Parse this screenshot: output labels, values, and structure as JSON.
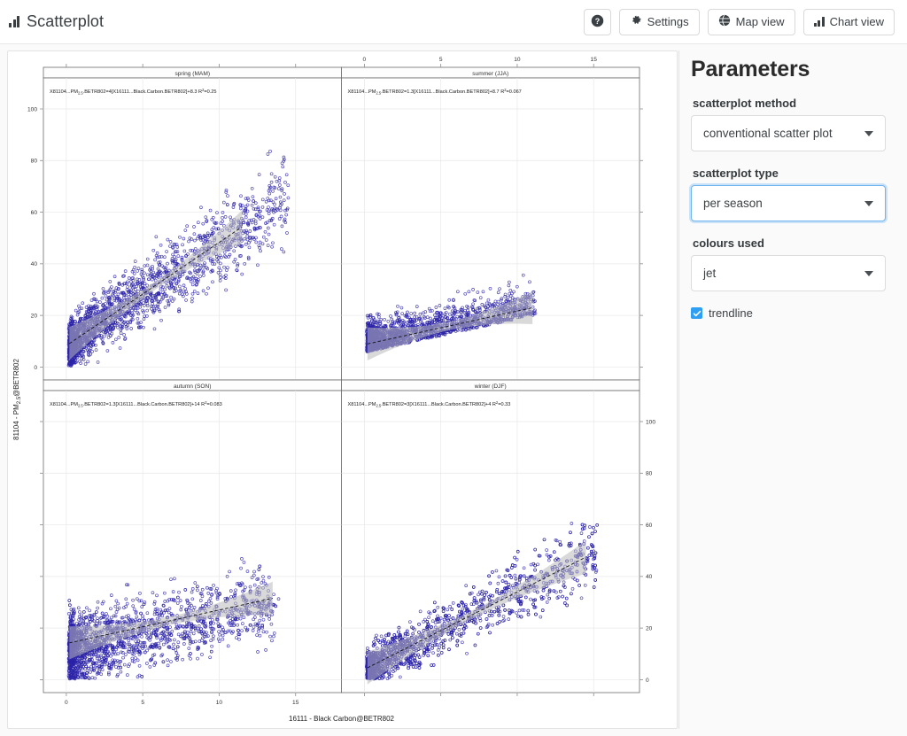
{
  "app": {
    "title": "Scatterplot",
    "logo_icon": "bar-chart-icon"
  },
  "toolbar": {
    "help_label": "?",
    "help_icon": "help-circle-icon",
    "settings_label": "Settings",
    "settings_icon": "gear-icon",
    "map_view_label": "Map view",
    "map_view_icon": "globe-icon",
    "chart_view_label": "Chart view",
    "chart_view_icon": "bar-chart-icon"
  },
  "sidebar": {
    "title": "Parameters",
    "fields": [
      {
        "label": "scatterplot method",
        "value": "conventional scatter plot",
        "focused": false
      },
      {
        "label": "scatterplot type",
        "value": "per season",
        "focused": true
      },
      {
        "label": "colours used",
        "value": "jet",
        "focused": false
      }
    ],
    "checkbox": {
      "label": "trendline",
      "checked": true,
      "accent": "#2e9ff2"
    }
  },
  "chart_data": {
    "type": "scatter",
    "title": "",
    "xlabel": "16111 - Black Carbon@BETR802",
    "ylabel": "81104 - PM2.5@BETR802",
    "layout": "2x2 facet (lattice/trellis)",
    "legend": "none",
    "grid": true,
    "point_color": "#2a22a8",
    "point_style": "open circle",
    "trendline": {
      "shown": true,
      "style": "dashed black line with grey confidence band"
    },
    "xlim": [
      -1.5,
      18
    ],
    "ylim": [
      -5,
      112
    ],
    "xticks": [
      0,
      5,
      10,
      15
    ],
    "yticks": [
      0,
      20,
      40,
      60,
      80,
      100
    ],
    "panels": [
      {
        "strip": "spring (MAM)",
        "position": "top-left",
        "equation": "X81104...PM2.5.BETR802=4[X16111...Black.Carbon.BETR802]+8.3 R²=0.25",
        "eq_parts": {
          "yvar": "X81104...PM",
          "ysub": "2.5",
          "yvar2": ".BETR802",
          "eq": "=",
          "slope": "4",
          "xvar": "[X16111...Black.Carbon.BETR802]",
          "intercept": "+8.3",
          "r2_label": "R",
          "r2_sup": "2",
          "r2_value": "=0.25"
        },
        "slope": 4,
        "intercept": 8.3,
        "r_squared": 0.25,
        "x_axis_labels": [],
        "y_axis_labels": [
          0,
          20,
          40,
          60,
          80,
          100
        ],
        "n_points_approx": 2000
      },
      {
        "strip": "summer (JJA)",
        "position": "top-right",
        "equation": "X81104...PM2.5.BETR802=1.3[X16111...Black.Carbon.BETR802]+8.7 R²=0.067",
        "eq_parts": {
          "yvar": "X81104...PM",
          "ysub": "2.5",
          "yvar2": ".BETR802",
          "eq": "=",
          "slope": "1.3",
          "xvar": "[X16111...Black.Carbon.BETR802]",
          "intercept": "+8.7",
          "r2_label": "R",
          "r2_sup": "2",
          "r2_value": "=0.067"
        },
        "slope": 1.3,
        "intercept": 8.7,
        "r_squared": 0.067,
        "x_axis_labels": [
          0,
          5,
          10,
          15
        ],
        "y_axis_labels": [],
        "n_points_approx": 1800
      },
      {
        "strip": "autumn (SON)",
        "position": "bottom-left",
        "equation": "X81104...PM2.5.BETR802=1.3[X16111...Black.Carbon.BETR802]+14 R²=0.083",
        "eq_parts": {
          "yvar": "X81104...PM",
          "ysub": "2.5",
          "yvar2": ".BETR802",
          "eq": "=",
          "slope": "1.3",
          "xvar": "[X16111...Black.Carbon.BETR802]",
          "intercept": "+14",
          "r2_label": "R",
          "r2_sup": "2",
          "r2_value": "=0.083"
        },
        "slope": 1.3,
        "intercept": 14,
        "r_squared": 0.083,
        "x_axis_labels": [
          0,
          5,
          10,
          15
        ],
        "y_axis_labels": [],
        "n_points_approx": 2000
      },
      {
        "strip": "winter (DJF)",
        "position": "bottom-right",
        "equation": "X81104...PM2.5.BETR802=3[X16111...Black.Carbon.BETR802]+4 R²=0.33",
        "eq_parts": {
          "yvar": "X81104...PM",
          "ysub": "2.5",
          "yvar2": ".BETR802",
          "eq": "=",
          "slope": "3",
          "xvar": "[X16111...Black.Carbon.BETR802]",
          "intercept": "+4",
          "r2_label": "R",
          "r2_sup": "2",
          "r2_value": "=0.33"
        },
        "slope": 3,
        "intercept": 4,
        "r_squared": 0.33,
        "x_axis_labels": [],
        "y_axis_labels": [
          0,
          20,
          40,
          60,
          80,
          100
        ],
        "n_points_approx": 2200
      }
    ]
  }
}
